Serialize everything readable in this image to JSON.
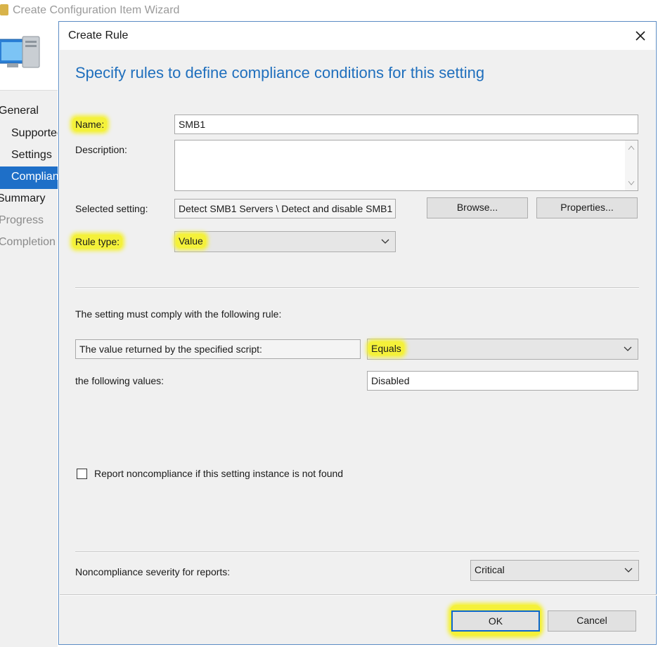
{
  "wizard": {
    "title": "Create Configuration Item Wizard",
    "sidebar": {
      "items": [
        {
          "label": "General"
        },
        {
          "label": "Supported Platforms"
        },
        {
          "label": "Settings"
        },
        {
          "label": "Compliance Rules"
        },
        {
          "label": "Summary"
        },
        {
          "label": "Progress"
        },
        {
          "label": "Completion"
        }
      ]
    }
  },
  "dialog": {
    "title": "Create Rule",
    "header": "Specify rules to define compliance conditions for this setting",
    "name_label": "Name:",
    "name_value": "SMB1",
    "description_label": "Description:",
    "description_value": "",
    "selected_setting_label": "Selected setting:",
    "selected_setting_value": "Detect SMB1 Servers \\ Detect and disable SMB1",
    "browse_label": "Browse...",
    "properties_label": "Properties...",
    "rule_type_label": "Rule type:",
    "rule_type_value": "Value",
    "rule_intro": "The setting must comply with the following rule:",
    "rule_subject": "The value returned by the specified script:",
    "operator_value": "Equals",
    "following_values_label": "the following values:",
    "following_values_value": "Disabled",
    "report_noncompliance_label": "Report noncompliance if this setting instance is not found",
    "report_noncompliance_checked": false,
    "severity_label": "Noncompliance severity for reports:",
    "severity_value": "Critical",
    "ok_label": "OK",
    "cancel_label": "Cancel"
  },
  "colors": {
    "header_blue": "#1f6fbd",
    "highlight": "#f4f13a",
    "dialog_bg": "#f0f0f0",
    "selected_nav": "#1e6fc8"
  }
}
